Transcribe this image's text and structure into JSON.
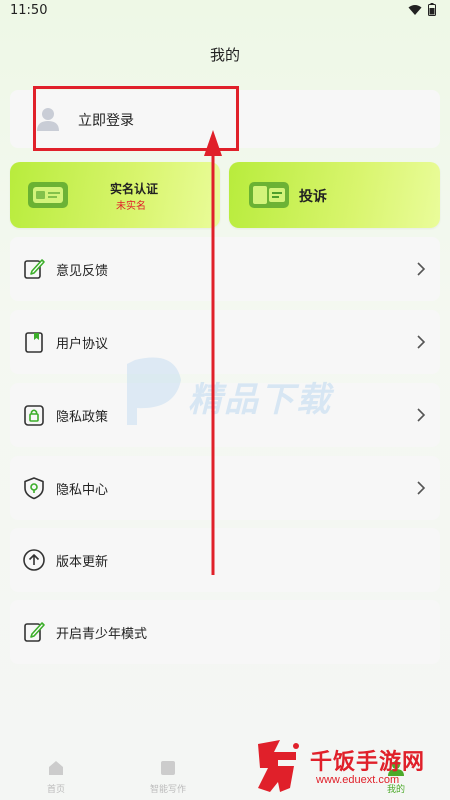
{
  "status": {
    "time": "11:50"
  },
  "page": {
    "title": "我的"
  },
  "login": {
    "label": "立即登录"
  },
  "verify": {
    "title": "实名认证",
    "status": "未实名"
  },
  "complaint": {
    "title": "投诉"
  },
  "menu": [
    {
      "label": "意见反馈",
      "icon": "feedback-icon",
      "chevron": true
    },
    {
      "label": "用户协议",
      "icon": "agreement-icon",
      "chevron": true
    },
    {
      "label": "隐私政策",
      "icon": "privacy-policy-icon",
      "chevron": true
    },
    {
      "label": "隐私中心",
      "icon": "privacy-center-icon",
      "chevron": true
    },
    {
      "label": "版本更新",
      "icon": "update-icon",
      "chevron": false
    },
    {
      "label": "开启青少年模式",
      "icon": "youth-mode-icon",
      "chevron": false
    }
  ],
  "nav": [
    {
      "label": "首页",
      "icon": "home-icon"
    },
    {
      "label": "智能写作",
      "icon": "writing-icon"
    },
    {
      "label": "我的",
      "icon": "profile-icon"
    }
  ],
  "watermark": {
    "brand": "千饭手游网",
    "url": "www.eduext.com",
    "center_text": "精品下载"
  },
  "colors": {
    "accent_green": "#b8ec3c",
    "annotation_red": "#e0202a",
    "nav_active": "#4caa2a"
  }
}
